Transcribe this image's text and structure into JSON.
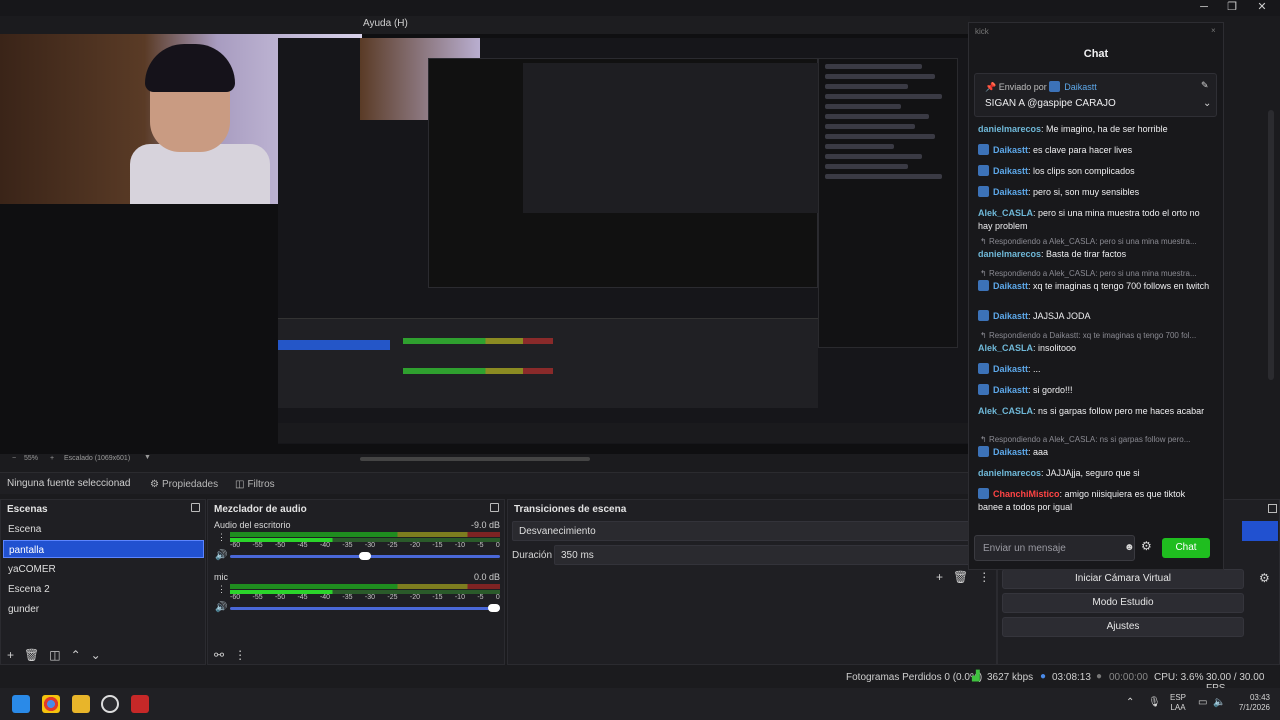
{
  "menu": {
    "help": "Ayuda (H)"
  },
  "preview": {
    "zoom": "55%",
    "scaled": "Escalado (1069x601)"
  },
  "properties_bar": {
    "no_source": "Ninguna fuente seleccionad",
    "properties": "Propiedades",
    "filters": "Filtros"
  },
  "scenes": {
    "title": "Escenas",
    "items": [
      "Escena",
      "pantalla",
      "yaCOMER",
      "Escena 2",
      "gunder"
    ],
    "selected": "pantalla"
  },
  "mixer": {
    "title": "Mezclador de audio",
    "channels": [
      {
        "name": "Audio del escritorio",
        "db": "-9.0 dB",
        "level": 0.5
      },
      {
        "name": "mic",
        "db": "0.0 dB",
        "level": 1.0
      }
    ],
    "ticks": [
      "-60",
      "-55",
      "-50",
      "-45",
      "-40",
      "-35",
      "-30",
      "-25",
      "-20",
      "-15",
      "-10",
      "-5",
      "0"
    ]
  },
  "transitions": {
    "title": "Transiciones de escena",
    "selected": "Desvanecimiento",
    "duration_label": "Duración",
    "duration_value": "350 ms"
  },
  "controls": {
    "virtual_camera": "Iniciar Cámara Virtual",
    "studio_mode": "Modo Estudio",
    "settings": "Ajustes"
  },
  "status": {
    "dropped_frames": "Fotogramas Perdidos 0 (0.0%)",
    "bitrate": "3627 kbps",
    "stream_time": "03:08:13",
    "rec_time": "00:00:00",
    "cpu": "CPU: 3.6%",
    "fps": "30.00 / 30.00 FPS"
  },
  "taskbar": {
    "lang": "ESP",
    "region": "LAA",
    "time": "03:43",
    "date": "7/1/2026"
  },
  "chat": {
    "top_label": "kick",
    "title": "Chat",
    "pinned_by_label": "Enviado por",
    "pinned_by_user": "Daikastt",
    "pinned_text": "SIGAN A @gaspipe CARAJO",
    "messages": [
      {
        "type": "msg",
        "user": "danielmarecos",
        "text": "Me imagino, ha de ser horrible",
        "color": "teal",
        "badge": false
      },
      {
        "type": "msg",
        "user": "Daikastt",
        "text": "es clave para hacer lives",
        "color": "blue",
        "badge": true
      },
      {
        "type": "msg",
        "user": "Daikastt",
        "text": "los clips son complicados",
        "color": "blue",
        "badge": true
      },
      {
        "type": "msg",
        "user": "Daikastt",
        "text": "pero si, son muy sensibles",
        "color": "blue",
        "badge": true
      },
      {
        "type": "msg",
        "user": "Alek_CASLA",
        "text": "pero si una mina muestra todo el orto no hay problem",
        "color": "teal",
        "badge": false
      },
      {
        "type": "reply",
        "text": "Respondiendo a Alek_CASLA: pero si una mina muestra..."
      },
      {
        "type": "msg",
        "user": "danielmarecos",
        "text": "Basta de tirar factos",
        "color": "teal",
        "badge": false
      },
      {
        "type": "reply",
        "text": "Respondiendo a Alek_CASLA: pero si una mina muestra..."
      },
      {
        "type": "msg",
        "user": "Daikastt",
        "text": "xq te imaginas q tengo 700 follows en twitch",
        "color": "blue",
        "badge": true
      },
      {
        "type": "msg",
        "user": "Daikastt",
        "text": "JAJSJA JODA",
        "color": "blue",
        "badge": true
      },
      {
        "type": "reply",
        "text": "Respondiendo a Daikastt: xq te imaginas q tengo 700 fol..."
      },
      {
        "type": "msg",
        "user": "Alek_CASLA",
        "text": "insolitooo",
        "color": "teal",
        "badge": false
      },
      {
        "type": "msg",
        "user": "Daikastt",
        "text": "...",
        "color": "blue",
        "badge": true
      },
      {
        "type": "msg",
        "user": "Daikastt",
        "text": "si gordo!!!",
        "color": "blue",
        "badge": true
      },
      {
        "type": "msg",
        "user": "Alek_CASLA",
        "text": "ns si garpas follow pero me haces acabar",
        "color": "teal",
        "badge": false
      },
      {
        "type": "reply",
        "text": "Respondiendo a Alek_CASLA: ns si garpas follow pero..."
      },
      {
        "type": "msg",
        "user": "Daikastt",
        "text": "aaa",
        "color": "blue",
        "badge": true
      },
      {
        "type": "msg",
        "user": "danielmarecos",
        "text": "JAJJAjja, seguro que si",
        "color": "teal",
        "badge": false
      },
      {
        "type": "msg",
        "user": "ChanchiMistico",
        "text": "amigo niisiquiera es que tiktok banee a todos por igual",
        "color": "red",
        "badge": true
      }
    ],
    "input_placeholder": "Enviar un mensaje",
    "send": "Chat"
  },
  "colors": {
    "accent": "#2151d0",
    "chat_send": "#1fbd1f",
    "meter_green": "#1f8d1f"
  }
}
